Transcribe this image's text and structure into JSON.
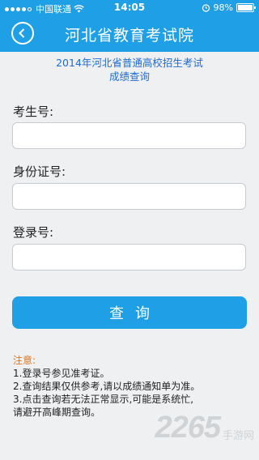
{
  "status_bar": {
    "carrier": "中国联通",
    "time": "14:05",
    "battery": "98%",
    "signal_bars_filled": 4,
    "signal_bars_total": 5
  },
  "header": {
    "title": "河北省教育考试院",
    "back_icon": "back-arrow-circle-icon"
  },
  "subtitle": {
    "line1": "2014年河北省普通高校招生考试",
    "line2": "成绩查询"
  },
  "form": {
    "exam_number_label": "考生号:",
    "exam_number_value": "",
    "id_number_label": "身份证号:",
    "id_number_value": "",
    "login_number_label": "登录号:",
    "login_number_value": "",
    "query_button": "查询"
  },
  "notes": {
    "title": "注意:",
    "lines": [
      "1.登录号参见准考证。",
      "2.查询结果仅供参考,请以成绩通知单为准。",
      "3.点击查询若无法正常显示,可能是系统忙,",
      "请避开高峰期查询。"
    ]
  },
  "watermark": {
    "number": "2265",
    "suffix": "手游网"
  },
  "colors": {
    "primary": "#1f9fe6",
    "subtitle": "#1f6bd1",
    "notes_title": "#e0761e",
    "background": "#eef0f2"
  }
}
